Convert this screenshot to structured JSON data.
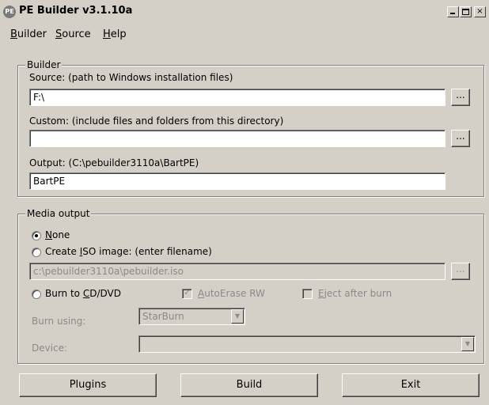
{
  "window": {
    "title": "PE Builder v3.1.10a",
    "icon_text": "PE",
    "controls": {
      "close": "×"
    }
  },
  "menu": [
    {
      "pre": "",
      "key": "B",
      "post": "uilder"
    },
    {
      "pre": "",
      "key": "S",
      "post": "ource"
    },
    {
      "pre": "",
      "key": "H",
      "post": "elp"
    }
  ],
  "builder": {
    "legend": "Builder",
    "source_label": "Source: (path to Windows installation files)",
    "source_value": "F:\\",
    "custom_label": "Custom: (include files and folders from this directory)",
    "custom_value": "",
    "output_label": "Output: (C:\\pebuilder3110a\\BartPE)",
    "output_value": "BartPE",
    "browse_label": "..."
  },
  "media": {
    "legend": "Media output",
    "none": {
      "key": "N",
      "post": "one",
      "selected": true
    },
    "iso": {
      "pre": "Create ",
      "key": "I",
      "post": "SO image: (enter filename)",
      "selected": false
    },
    "iso_value": "c:\\pebuilder3110a\\pebuilder.iso",
    "burn": {
      "pre": "Burn to ",
      "key": "C",
      "post": "D/DVD",
      "selected": false
    },
    "autoerase": {
      "key": "A",
      "post": "utoErase RW",
      "checked": true,
      "check_glyph": "✓"
    },
    "eject": {
      "key": "E",
      "post": "ject after burn",
      "checked": false
    },
    "burn_using_label": "Burn using:",
    "burn_using_value": "StarBurn",
    "device_label": "Device:",
    "device_value": "",
    "combo_arrow": "▼",
    "browse_label": "..."
  },
  "buttons": {
    "plugins": "Plugins",
    "build": "Build",
    "exit": "Exit"
  }
}
